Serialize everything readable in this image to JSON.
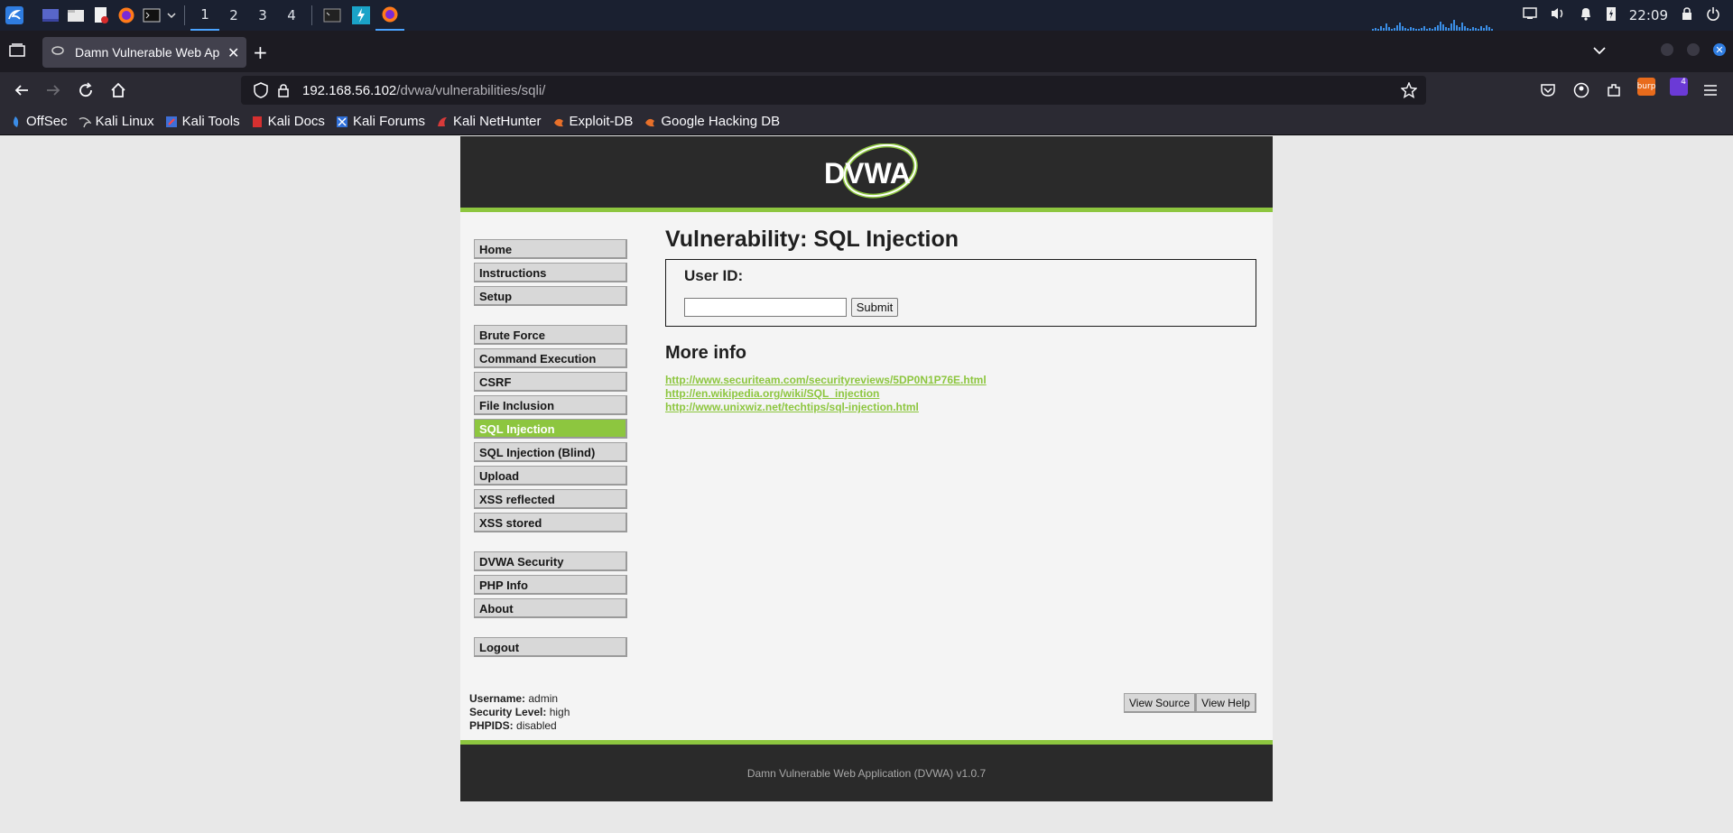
{
  "panel": {
    "workspaces": [
      "1",
      "2",
      "3",
      "4"
    ],
    "active_workspace": "1",
    "clock": "22:09",
    "notification_badge": "4"
  },
  "browser": {
    "tab_title": "Damn Vulnerable Web Ap",
    "url_host": "192.168.56.102",
    "url_path": "/dvwa/vulnerabilities/sqli/",
    "bookmarks": [
      "OffSec",
      "Kali Linux",
      "Kali Tools",
      "Kali Docs",
      "Kali Forums",
      "Kali NetHunter",
      "Exploit-DB",
      "Google Hacking DB"
    ]
  },
  "dvwa": {
    "logo_text": "DVWA",
    "menu_group1": [
      "Home",
      "Instructions",
      "Setup"
    ],
    "menu_group2": [
      "Brute Force",
      "Command Execution",
      "CSRF",
      "File Inclusion",
      "SQL Injection",
      "SQL Injection (Blind)",
      "Upload",
      "XSS reflected",
      "XSS stored"
    ],
    "menu_group3": [
      "DVWA Security",
      "PHP Info",
      "About"
    ],
    "menu_group4": [
      "Logout"
    ],
    "selected_item": "SQL Injection",
    "page_title": "Vulnerability: SQL Injection",
    "user_id_label": "User ID:",
    "user_id_value": "",
    "submit_label": "Submit",
    "more_info_title": "More info",
    "links": [
      "http://www.securiteam.com/securityreviews/5DP0N1P76E.html",
      "http://en.wikipedia.org/wiki/SQL_injection",
      "http://www.unixwiz.net/techtips/sql-injection.html"
    ],
    "username_label": "Username:",
    "username": "admin",
    "security_label": "Security Level:",
    "security_level": "high",
    "phpids_label": "PHPIDS:",
    "phpids": "disabled",
    "view_source_label": "View Source",
    "view_help_label": "View Help",
    "footer_text": "Damn Vulnerable Web Application (DVWA) v1.0.7"
  },
  "colors": {
    "accent_green": "#8dc63f",
    "header_dark": "#2a2a2a",
    "browser_chrome": "#2b2a33",
    "panel_bg": "#1a2030"
  }
}
